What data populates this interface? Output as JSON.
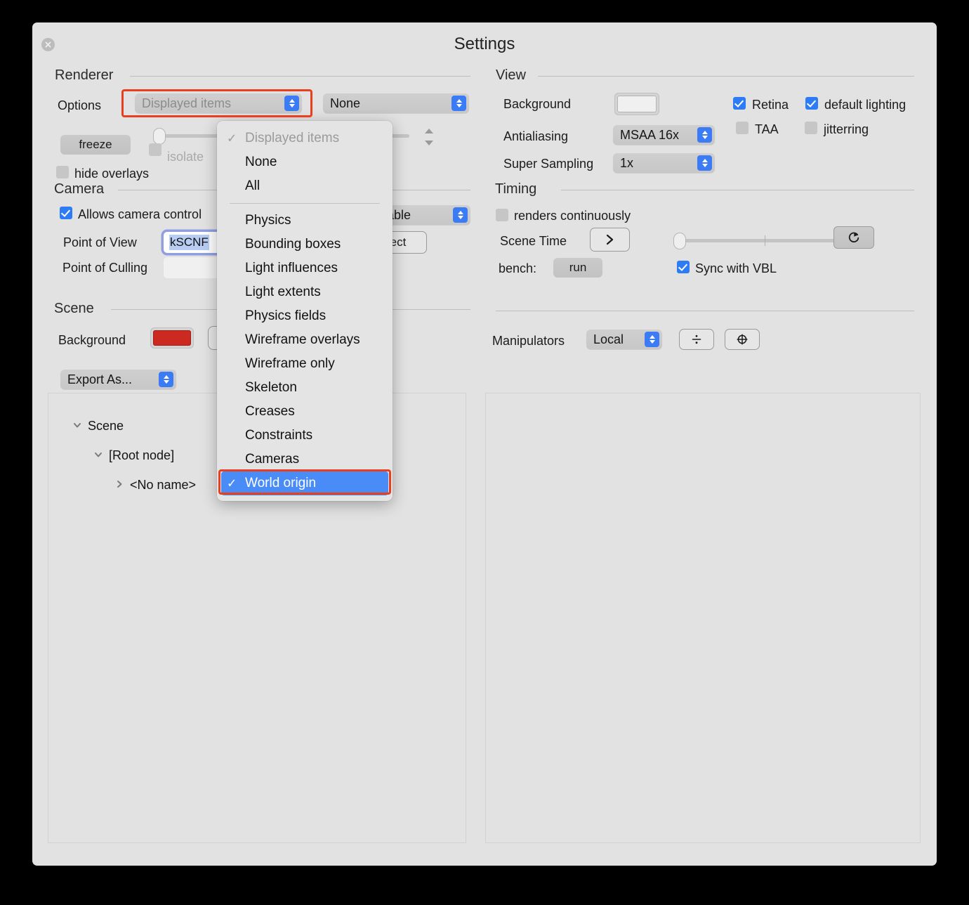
{
  "window": {
    "title": "Settings",
    "close_icon": "close-icon"
  },
  "renderer": {
    "group_title": "Renderer",
    "options_label": "Options",
    "options_popup_value": "Displayed items",
    "secondary_popup_value": "None",
    "freeze_button": "freeze",
    "isolate_label": "isolate",
    "hide_overlays_label": "hide overlays",
    "hide_overlays_checked": false,
    "isolate_checked": false
  },
  "menu": {
    "items": [
      {
        "label": "Displayed items",
        "checked": true,
        "disabled": true,
        "selected": false,
        "separator_after": false
      },
      {
        "label": "None",
        "checked": false,
        "disabled": false,
        "selected": false,
        "separator_after": false
      },
      {
        "label": "All",
        "checked": false,
        "disabled": false,
        "selected": false,
        "separator_after": true
      },
      {
        "label": "Physics",
        "checked": false,
        "disabled": false,
        "selected": false,
        "separator_after": false
      },
      {
        "label": "Bounding boxes",
        "checked": false,
        "disabled": false,
        "selected": false,
        "separator_after": false
      },
      {
        "label": "Light influences",
        "checked": false,
        "disabled": false,
        "selected": false,
        "separator_after": false
      },
      {
        "label": "Light extents",
        "checked": false,
        "disabled": false,
        "selected": false,
        "separator_after": false
      },
      {
        "label": "Physics fields",
        "checked": false,
        "disabled": false,
        "selected": false,
        "separator_after": false
      },
      {
        "label": "Wireframe overlays",
        "checked": false,
        "disabled": false,
        "selected": false,
        "separator_after": false
      },
      {
        "label": "Wireframe only",
        "checked": false,
        "disabled": false,
        "selected": false,
        "separator_after": false
      },
      {
        "label": "Skeleton",
        "checked": false,
        "disabled": false,
        "selected": false,
        "separator_after": false
      },
      {
        "label": "Creases",
        "checked": false,
        "disabled": false,
        "selected": false,
        "separator_after": false
      },
      {
        "label": "Constraints",
        "checked": false,
        "disabled": false,
        "selected": false,
        "separator_after": false
      },
      {
        "label": "Cameras",
        "checked": false,
        "disabled": false,
        "selected": false,
        "separator_after": false
      },
      {
        "label": "World origin",
        "checked": true,
        "disabled": false,
        "selected": true,
        "separator_after": false
      }
    ]
  },
  "camera": {
    "group_title": "Camera",
    "allows_camera_control_label": "Allows camera control",
    "allows_camera_control_checked": true,
    "point_of_view_label": "Point of View",
    "point_of_view_value": "kSCNF",
    "point_of_culling_label": "Point of Culling",
    "point_of_culling_value": "",
    "hidden_popup_value": "ntable",
    "hidden_button_label": "ect"
  },
  "scene": {
    "group_title": "Scene",
    "background_label": "Background",
    "background_color": "#cc2a21",
    "export_as_label": "Export As..."
  },
  "view": {
    "group_title": "View",
    "background_label": "Background",
    "background_color": "#f0f0f0",
    "antialiasing_label": "Antialiasing",
    "antialiasing_value": "MSAA 16x",
    "super_sampling_label": "Super Sampling",
    "super_sampling_value": "1x",
    "retina_label": "Retina",
    "retina_checked": true,
    "default_lighting_label": "default lighting",
    "default_lighting_checked": true,
    "taa_label": "TAA",
    "taa_checked": false,
    "jitterring_label": "jitterring",
    "jitterring_checked": false
  },
  "timing": {
    "group_title": "Timing",
    "renders_continuously_label": "renders continuously",
    "renders_continuously_checked": false,
    "scene_time_label": "Scene Time",
    "play_icon": "play-chevron-icon",
    "reset_icon": "reset-circular-arrow-icon",
    "bench_label": "bench:",
    "run_button": "run",
    "sync_with_vbl_label": "Sync with VBL",
    "sync_with_vbl_checked": true
  },
  "manipulators": {
    "label": "Manipulators",
    "mode_value": "Local",
    "button1_icon": "divide-icon",
    "button2_icon": "circle-plus-icon"
  },
  "tree": {
    "rows": [
      {
        "label": "Scene",
        "twisty": "chevron-down-icon",
        "indent": 0
      },
      {
        "label": "[Root node]",
        "twisty": "chevron-down-icon",
        "indent": 1
      },
      {
        "label": "<No name>",
        "twisty": "chevron-right-icon",
        "indent": 2
      }
    ]
  },
  "annotations": {
    "highlight_color": "#e8401f"
  }
}
